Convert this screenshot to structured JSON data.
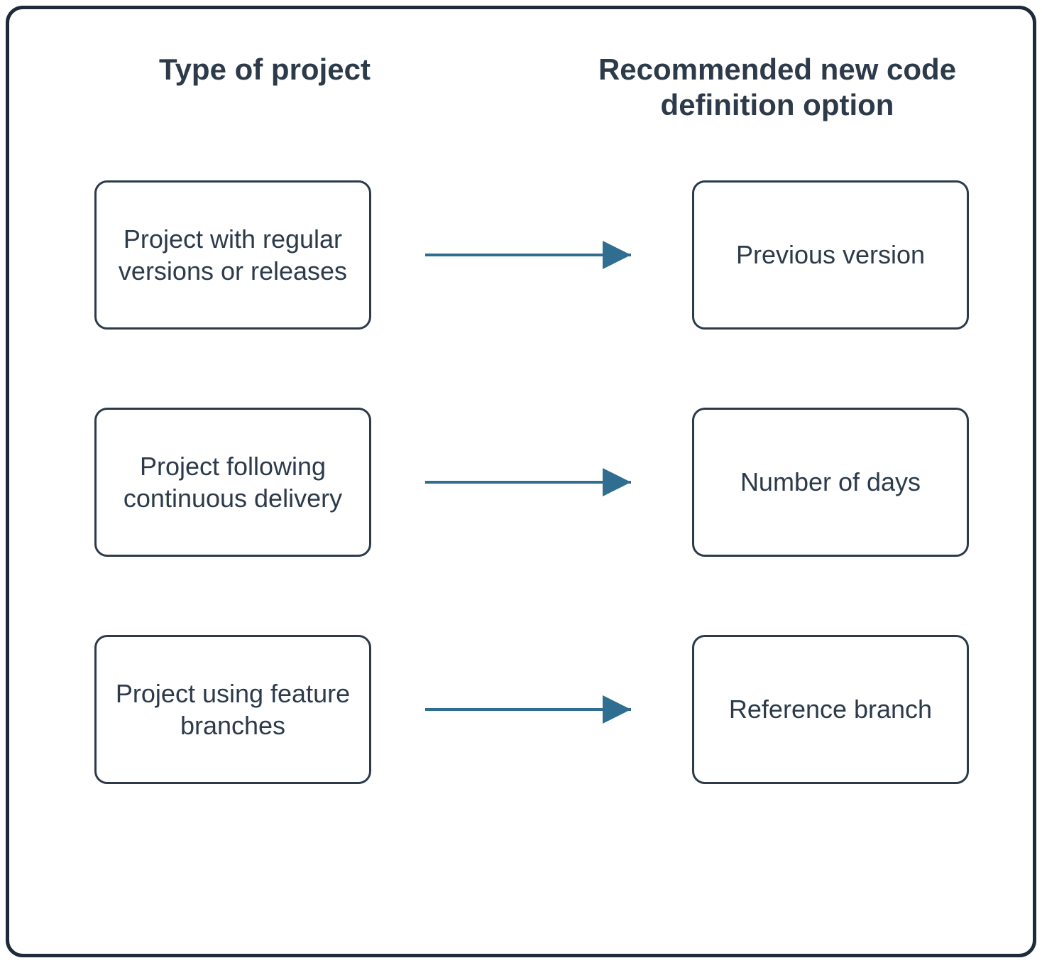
{
  "headers": {
    "left": "Type of project",
    "right": "Recommended new code definition option"
  },
  "rows": [
    {
      "left": "Project with regular versions or releases",
      "right": "Previous version"
    },
    {
      "left": "Project following continuous delivery",
      "right": "Number of days"
    },
    {
      "left": "Project using feature branches",
      "right": "Reference branch"
    }
  ],
  "colors": {
    "border": "#1f2a3a",
    "text": "#2c3a4a",
    "arrow": "#2f6e91"
  }
}
